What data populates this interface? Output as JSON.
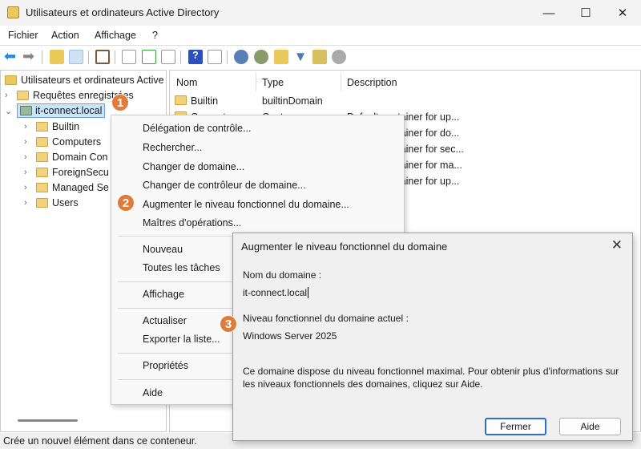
{
  "window": {
    "title": "Utilisateurs et ordinateurs Active Directory"
  },
  "menu": [
    "Fichier",
    "Action",
    "Affichage",
    "?"
  ],
  "tree": {
    "root": "Utilisateurs et ordinateurs Active",
    "saved": "Requêtes enregistrées",
    "domain": "it-connect.local",
    "children": [
      "Builtin",
      "Computers",
      "Domain Con",
      "ForeignSecu",
      "Managed Se",
      "Users"
    ]
  },
  "list": {
    "headers": [
      "Nom",
      "Type",
      "Description"
    ],
    "rows": [
      {
        "name": "Builtin",
        "type": "builtinDomain",
        "desc": ""
      },
      {
        "name": "Computers",
        "type": "Conteneur",
        "desc": "Default container for up..."
      },
      {
        "name": "",
        "type": "",
        "desc": "Default container for do..."
      },
      {
        "name": "",
        "type": "",
        "desc": "Default container for sec..."
      },
      {
        "name": "",
        "type": "",
        "desc": "Default container for ma..."
      },
      {
        "name": "",
        "type": "",
        "desc": "Default container for up..."
      }
    ]
  },
  "context_menu": [
    "Délégation de contrôle...",
    "Rechercher...",
    "Changer de domaine...",
    "Changer de contrôleur de domaine...",
    "Augmenter le niveau fonctionnel du domaine...",
    "Maîtres d'opérations...",
    "Nouveau",
    "Toutes les tâches",
    "Affichage",
    "Actualiser",
    "Exporter la liste...",
    "Propriétés",
    "Aide"
  ],
  "dialog": {
    "title": "Augmenter le niveau fonctionnel du domaine",
    "domain_label": "Nom du domaine :",
    "domain_value": "it-connect.local",
    "level_label": "Niveau fonctionnel du domaine actuel :",
    "level_value": "Windows Server 2025",
    "info": "Ce domaine dispose du niveau fonctionnel maximal. Pour obtenir plus d'informations sur les niveaux fonctionnels des domaines, cliquez sur Aide.",
    "close_button": "Fermer",
    "help_button": "Aide"
  },
  "badges": [
    "1",
    "2",
    "3"
  ],
  "status": "Crée un nouvel élément dans ce conteneur.",
  "colors": {
    "badge": "#e07b39",
    "selection": "#cce4f7"
  }
}
